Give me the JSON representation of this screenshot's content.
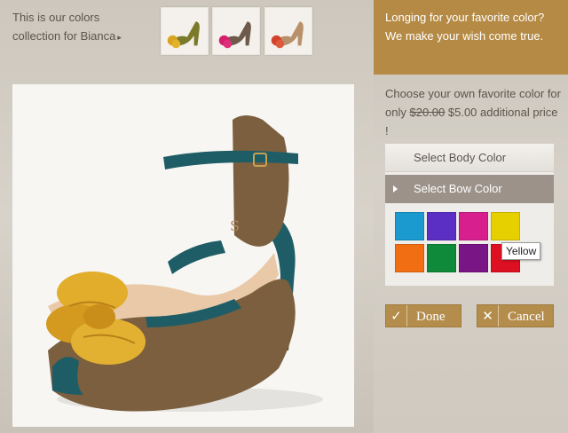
{
  "left": {
    "collection_text": "This is our colors collection for Bianca",
    "collection_arrow": "▸",
    "thumbnails": [
      {
        "name": "green-yellow-sandal",
        "bow_color": "#d9a21f",
        "body_color": "#7a7a2a"
      },
      {
        "name": "brown-pink-sandal",
        "bow_color": "#d4206c",
        "body_color": "#6e5a4a"
      },
      {
        "name": "tan-red-sandal",
        "bow_color": "#d2422c",
        "body_color": "#b8916a"
      }
    ]
  },
  "right": {
    "header_text": "Longing for your favorite color? We make your wish come true.",
    "choose_prefix": "Choose your own favorite color for only",
    "old_price": "$20.00",
    "new_price": "$5.00",
    "choose_suffix": "additional price !",
    "select_body_label": "Select Body Color",
    "select_bow_label": "Select Bow Color",
    "swatches": [
      {
        "name": "blue",
        "color": "#1b9ad0"
      },
      {
        "name": "purple",
        "color": "#5b2fc4"
      },
      {
        "name": "pink",
        "color": "#d81f8e"
      },
      {
        "name": "yellow",
        "color": "#e7d000"
      },
      {
        "name": "orange",
        "color": "#f26e12"
      },
      {
        "name": "green",
        "color": "#0f8a3a"
      },
      {
        "name": "violet",
        "color": "#7a1585"
      },
      {
        "name": "red",
        "color": "#dc1020"
      }
    ],
    "tooltip": "Yellow",
    "done_label": "Done",
    "cancel_label": "Cancel",
    "done_icon": "✓",
    "cancel_icon": "✕"
  },
  "colors": {
    "accent": "#b58a45",
    "shoe_body": "#7b5f3e",
    "shoe_strap": "#1f5d66",
    "shoe_bow": "#e1ad2a"
  }
}
